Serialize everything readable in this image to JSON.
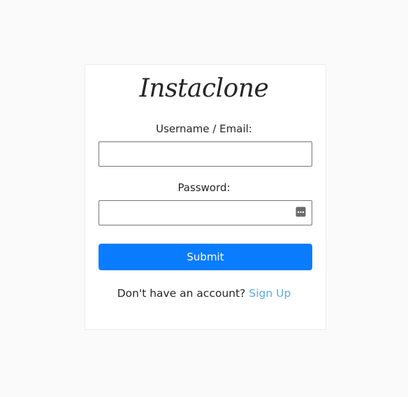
{
  "app": {
    "logo_text": "Instaclone"
  },
  "login_form": {
    "username_label": "Username / Email:",
    "username_value": "",
    "password_label": "Password:",
    "password_value": "",
    "submit_label": "Submit"
  },
  "signup": {
    "prompt": "Don't have an account?",
    "link_label": "Sign Up"
  },
  "colors": {
    "accent": "#0a7cff",
    "link": "#5aa9e6",
    "background": "#fafafa"
  },
  "icons": {
    "password_manager": "password-key-icon"
  }
}
